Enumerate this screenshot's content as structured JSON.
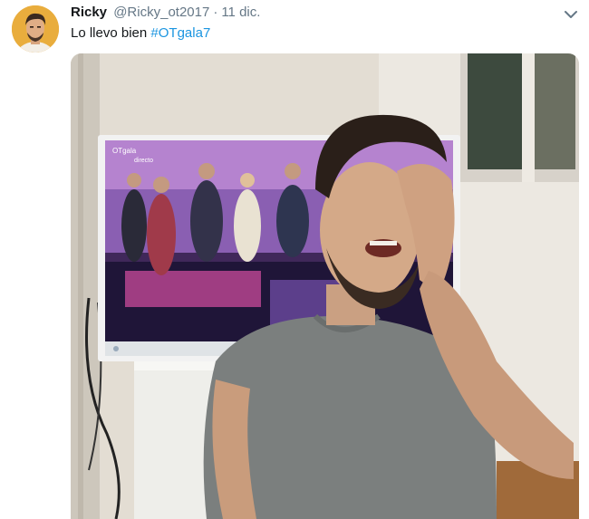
{
  "tweet": {
    "author_name": "Ricky",
    "handle": "@Ricky_ot2017",
    "separator": "·",
    "time": "11 dic.",
    "text": "Lo llevo bien",
    "hashtag": "#OTgala7",
    "avatar_icon": "user-avatar",
    "menu_icon": "chevron-down-icon"
  },
  "media": {
    "tv_logo": "OTgala",
    "tv_badge": "directo"
  },
  "colors": {
    "link": "#1b95e0",
    "secondary_text": "#657786",
    "primary_text": "#14171a"
  }
}
